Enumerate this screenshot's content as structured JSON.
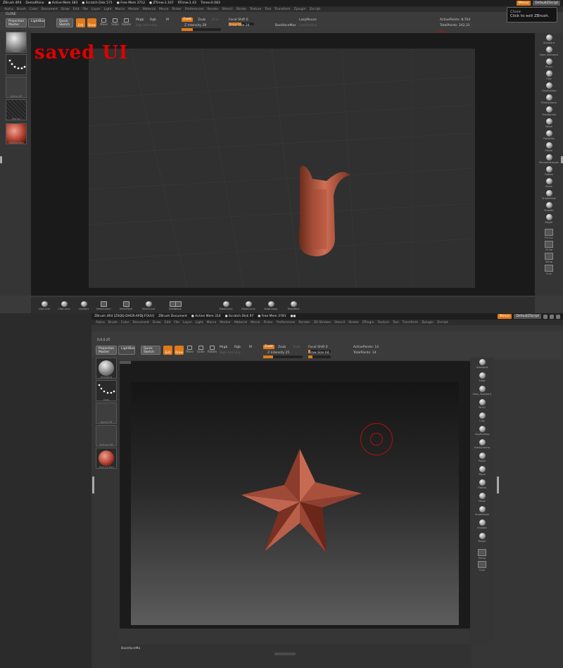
{
  "window1": {
    "title_segments": [
      "ZBrush 4R4",
      "DemoRhino",
      "● Active Mem 383",
      "● Scratch Disk 571",
      "● Free Mem 3712",
      "● ZTime▹1.167",
      "RTime▹1.43",
      "Timer▹0.083"
    ],
    "menu_label": "Menus",
    "script_label": "DefaultZScript",
    "menus": [
      "Alpha",
      "Brush",
      "Color",
      "Document",
      "Draw",
      "Edit",
      "File",
      "Layer",
      "Light",
      "Macro",
      "Marker",
      "Material",
      "Movie",
      "Picker",
      "Preferences",
      "Render",
      "Stencil",
      "Stroke",
      "Texture",
      "Tool",
      "Transform",
      "Zplugin",
      "Zscript"
    ],
    "close_label": "CLOSE",
    "toolbar": {
      "projection_master": "Projection Master",
      "lightbox": "LightBox",
      "quick_sketch": "Quick Sketch",
      "edit": "Edit",
      "draw": "Draw",
      "move": "Move",
      "scale": "Scale",
      "rotate": "Rotate",
      "mrgb": "Mrgb",
      "rgb": "Rgb",
      "m": "M",
      "rgb_intensity": "Rgb Intensity",
      "zadd": "Zadd",
      "zsub": "Zsub",
      "zcut": "Zcut",
      "z_intensity": "Z Intensity 28",
      "focal_shift": "Focal Shift 0",
      "draw_size": "Draw Size 24",
      "backface": "BackfaceMas",
      "lazymouse": "LazyMouse",
      "lazyradius": "LazyRadius",
      "active_points": "ActivePoints: 8,704",
      "total_points": "TotalPoints: 242,31"
    },
    "tooltip": {
      "line1": "Close",
      "line2": "Click to exit ZBrush."
    },
    "overlay_text": "saved UI",
    "left_thumbs": [
      "Inflat",
      "",
      "Alpha Off",
      "Texture",
      "MatCap Red"
    ],
    "right_brushes": [
      "Standard",
      "Dam_Standard",
      "Pinch",
      "Clay",
      "ClayBuildup",
      "TrimDynamic",
      "TrimNormal",
      "Polish",
      "Polishflat",
      "Planar",
      "PlanarFlatAngle",
      "Flatten",
      "Move",
      "SnakeHook",
      "Smooth",
      "Morph"
    ],
    "right_extras": [
      "Fill Cur",
      "P3 Sel",
      "Setup",
      "Curv"
    ],
    "bottom_buttons": [
      "ClipCircle",
      "ClipCurve",
      "ClipRect",
      "SelectLasso",
      "SelectRect",
      "SliceCurve",
      "Select",
      "Lasso",
      "MaskCircle",
      "MaskCurve",
      "MaskLasso",
      "MaskRect"
    ]
  },
  "window2": {
    "title_segments": [
      "ZBrush 4R4 [ZSQQ-DHOX-APDJ-FOUV]",
      "ZBrush Document",
      "● Active Mem 314",
      "● Scratch Disk 97",
      "● Free Mem 3781",
      "●●"
    ],
    "menu_label": "Menus",
    "script_label": "DefaultZScript",
    "menus": [
      "Alpha",
      "Brush",
      "Color",
      "Document",
      "Draw",
      "Edit",
      "File",
      "Layer",
      "Light",
      "Macro",
      "Marker",
      "Material",
      "Movie",
      "Picker",
      "Preferences",
      "Render",
      "3D-Strokes",
      "Stencil",
      "Stroke",
      "ZPlugin",
      "Texture",
      "Tool",
      "Transform",
      "Zplugin",
      "Zscript"
    ],
    "coords": "0,0,0.25",
    "toolbar": {
      "projection_master": "Projection Master",
      "lightbox": "LightBox",
      "quick_sketch": "Quick Sketch",
      "edit": "Edit",
      "draw": "Draw",
      "move": "Move",
      "scale": "Scale",
      "rotate": "Rotate",
      "mrgb": "Mrgb",
      "rgb": "Rgb",
      "m": "M",
      "rgb_intensity": "Rgb Intensity",
      "zadd": "Zadd",
      "zsub": "Zsub",
      "zcut": "Zcut",
      "z_intensity": "Z Intensity 25",
      "focal_shift": "Focal Shift 0",
      "draw_size": "Draw Size 64",
      "active_points": "ActivePoints: 14",
      "total_points": "TotalPoints: 14"
    },
    "left_thumbs": [
      "Standard",
      "Dots",
      "Alpha Off",
      "Texture Off",
      "MatCap Red"
    ],
    "right_brushes": [
      "Standard",
      "Inflat",
      "Dam_Standard",
      "Pinch",
      "Clay",
      "ClayBuildup",
      "TrimDynamic",
      "Polish",
      "Plane",
      "Flatten",
      "Move",
      "SnakeHook",
      "Smooth",
      "Morph"
    ],
    "right_extras": [
      "Setup",
      "Curv"
    ],
    "bottom_label": "BackfaceMa"
  }
}
